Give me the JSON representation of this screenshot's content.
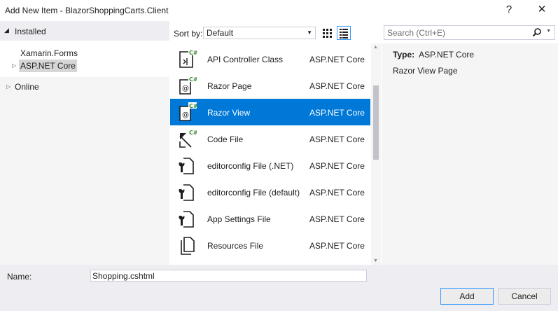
{
  "window": {
    "title": "Add New Item - BlazorShoppingCarts.Client",
    "help_glyph": "?",
    "close_glyph": "✕"
  },
  "tree": {
    "installed_label": "Installed",
    "items": [
      {
        "label": "Xamarin.Forms"
      },
      {
        "label": "ASP.NET Core"
      },
      {
        "label": "Online"
      }
    ]
  },
  "toolbar": {
    "sort_label": "Sort by:",
    "sort_value": "Default",
    "search_placeholder": "Search (Ctrl+E)"
  },
  "templates": [
    {
      "name": "API Controller Class",
      "type": "ASP.NET Core",
      "icon": "api-controller-icon"
    },
    {
      "name": "Razor Page",
      "type": "ASP.NET Core",
      "icon": "razor-page-icon"
    },
    {
      "name": "Razor View",
      "type": "ASP.NET Core",
      "icon": "razor-view-icon",
      "selected": true
    },
    {
      "name": "Code File",
      "type": "ASP.NET Core",
      "icon": "code-file-icon"
    },
    {
      "name": "editorconfig File (.NET)",
      "type": "ASP.NET Core",
      "icon": "editorconfig-icon"
    },
    {
      "name": "editorconfig File (default)",
      "type": "ASP.NET Core",
      "icon": "editorconfig-icon"
    },
    {
      "name": "App Settings File",
      "type": "ASP.NET Core",
      "icon": "settings-file-icon"
    },
    {
      "name": "Resources File",
      "type": "ASP.NET Core",
      "icon": "resources-file-icon"
    }
  ],
  "details": {
    "type_label": "Type:",
    "type_value": "ASP.NET Core",
    "description": "Razor View Page"
  },
  "footer": {
    "name_label": "Name:",
    "name_value": "Shopping.cshtml",
    "add_label": "Add",
    "cancel_label": "Cancel"
  },
  "colors": {
    "selection": "#0078d7",
    "accent_border": "#3399ff",
    "pane_background": "#f5f5f5",
    "footer_background": "#eeeef2"
  }
}
